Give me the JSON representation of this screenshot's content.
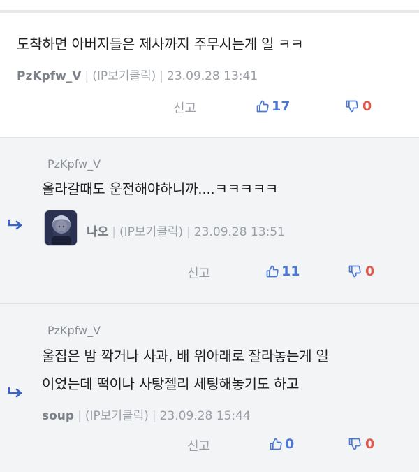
{
  "comments": [
    {
      "text": "도착하면 아버지들은 제사까지 주무시는게 일 ㅋㅋ",
      "author": "PzKpfw_V",
      "ip": "(IP보기클릭)",
      "date": "23.09.28 13:41",
      "report": "신고",
      "likes": "17",
      "dislikes": "0"
    }
  ],
  "replies": [
    {
      "reply_to": "PzKpfw_V",
      "text": "올라갈때도 운전해야하니까....ㅋㅋㅋㅋㅋ",
      "author": "나오",
      "ip": "(IP보기클릭)",
      "date": "23.09.28 13:51",
      "report": "신고",
      "likes": "11",
      "dislikes": "0"
    },
    {
      "reply_to": "PzKpfw_V",
      "text_line1": "울집은 밤 깍거나 사과, 배 위아래로 잘라놓는게 일",
      "text_line2": "이었는데 떡이나 사탕젤리 세팅해놓기도 하고",
      "author": "soup",
      "ip": "(IP보기클릭)",
      "date": "23.09.28 15:44",
      "report": "신고",
      "likes": "0",
      "dislikes": "0"
    }
  ],
  "icons": {
    "like": "thumbs-up-icon",
    "dislike": "thumbs-down-icon",
    "reply": "reply-arrow-icon"
  },
  "colors": {
    "like": "#4a78d4",
    "dislike": "#e0584c",
    "reply_bg": "#f3f4f6"
  }
}
